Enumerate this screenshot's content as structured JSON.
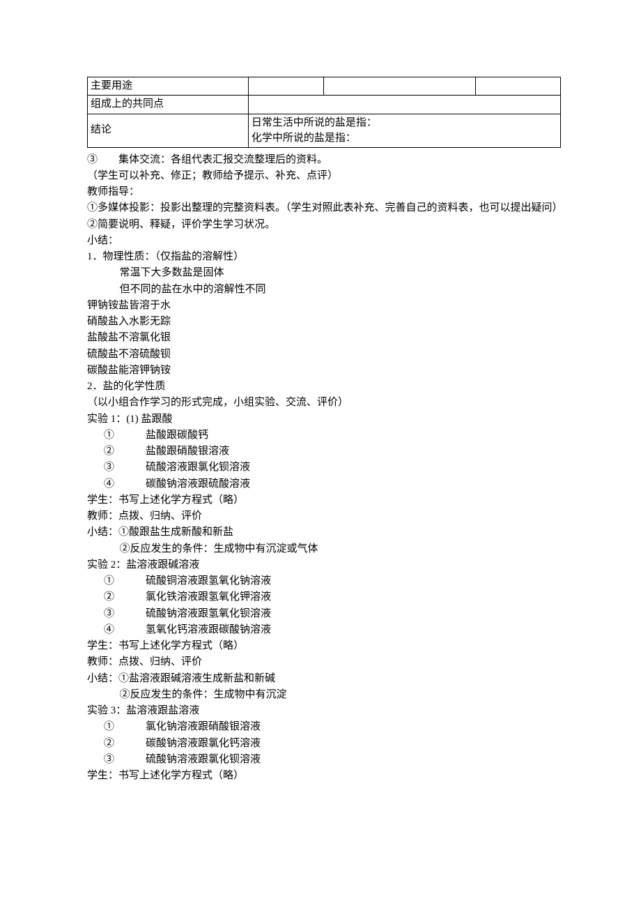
{
  "table": {
    "row1_label": "主要用途",
    "row2_label": "组成上的共同点",
    "row3_label": "结论",
    "row3_line1": "日常生活中所说的盐是指：",
    "row3_line2": "化学中所说的盐是指："
  },
  "lines": {
    "l0": "③　　集体交流：各组代表汇报交流整理后的资料。",
    "l1": "（学生可以补充、修正；教师给予提示、补充、点评）",
    "l2": "教师指导：",
    "l3": "①多媒体投影：投影出整理的完整资料表。（学生对照此表补充、完善自己的资料表，也可以提出疑问）",
    "l4": "②简要说明、释疑，评价学生学习状况。",
    "l5": "小结：",
    "l6": "1．物理性质：（仅指盐的溶解性）",
    "l7": "常温下大多数盐是固体",
    "l8": "但不同的盐在水中的溶解性不同",
    "l9": "钾钠铵盐皆溶于水",
    "l10": "硝酸盐入水影无踪",
    "l11": "盐酸盐不溶氯化银",
    "l12": "硫酸盐不溶硫酸钡",
    "l13": "碳酸盐能溶钾钠铵",
    "l14": "2．盐的化学性质",
    "l15": "（以小组合作学习的形式完成，小组实验、交流、评价）",
    "l16": "实验 1：(1) 盐跟酸",
    "l17": "①　　　盐酸跟碳酸钙",
    "l18": "②　　　盐酸跟硝酸银溶液",
    "l19": "③　　　硫酸溶液跟氯化钡溶液",
    "l20": "④　　　碳酸钠溶液跟硫酸溶液",
    "l21": "学生：书写上述化学方程式（略）",
    "l22": "教师：点拨、归纳、评价",
    "l23": "小结：①酸跟盐生成新酸和新盐",
    "l24": "②反应发生的条件：生成物中有沉淀或气体",
    "l25": "实验 2：盐溶液跟碱溶液",
    "l26": "①　　　硫酸铜溶液跟氢氧化钠溶液",
    "l27": "②　　　氯化铁溶液跟氢氧化钾溶液",
    "l28": "③　　　硫酸钠溶液跟氢氧化钡溶液",
    "l29": "④　　　氢氧化钙溶液跟碳酸钠溶液",
    "l30": "学生：书写上述化学方程式（略）",
    "l31": "教师：点拨、归纳、评价",
    "l32": "小结：①盐溶液跟碱溶液生成新盐和新碱",
    "l33": "②反应发生的条件：生成物中有沉淀",
    "l34": "实验 3：盐溶液跟盐溶液",
    "l35": "①　　　氯化钠溶液跟硝酸银溶液",
    "l36": "②　　　碳酸钠溶液跟氯化钙溶液",
    "l37": "③　　　硫酸钠溶液跟氯化钡溶液",
    "l38": "学生：书写上述化学方程式（略）"
  }
}
